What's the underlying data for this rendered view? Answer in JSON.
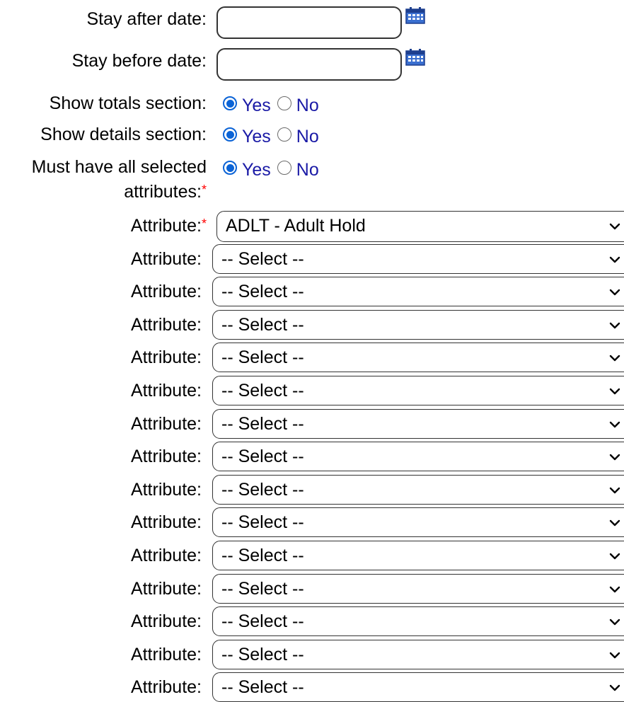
{
  "fields": {
    "stay_after": {
      "label": "Stay after date:",
      "value": ""
    },
    "stay_before": {
      "label": "Stay before date:",
      "value": ""
    },
    "calendar_icon": "calendar-icon"
  },
  "options": {
    "yes": "Yes",
    "no": "No"
  },
  "show_totals": {
    "label": "Show totals section:",
    "selected": "Yes"
  },
  "show_details": {
    "label": "Show details section:",
    "selected": "Yes"
  },
  "must_have_all": {
    "label_line1": "Must have all selected",
    "label_line2": "attributes:",
    "required_mark": "*",
    "selected": "Yes"
  },
  "attribute_label": "Attribute:",
  "attributes": [
    {
      "value": "ADLT - Adult Hold",
      "required": true
    },
    {
      "value": "-- Select --"
    },
    {
      "value": "-- Select --"
    },
    {
      "value": "-- Select --"
    },
    {
      "value": "-- Select --"
    },
    {
      "value": "-- Select --"
    },
    {
      "value": "-- Select --"
    },
    {
      "value": "-- Select --"
    },
    {
      "value": "-- Select --"
    },
    {
      "value": "-- Select --"
    },
    {
      "value": "-- Select --"
    },
    {
      "value": "-- Select --"
    },
    {
      "value": "-- Select --"
    },
    {
      "value": "-- Select --"
    },
    {
      "value": "-- Select --"
    }
  ],
  "colors": {
    "radio_accent": "#0b63d6",
    "option_text": "#1a1aa6",
    "required": "#ff0000"
  }
}
